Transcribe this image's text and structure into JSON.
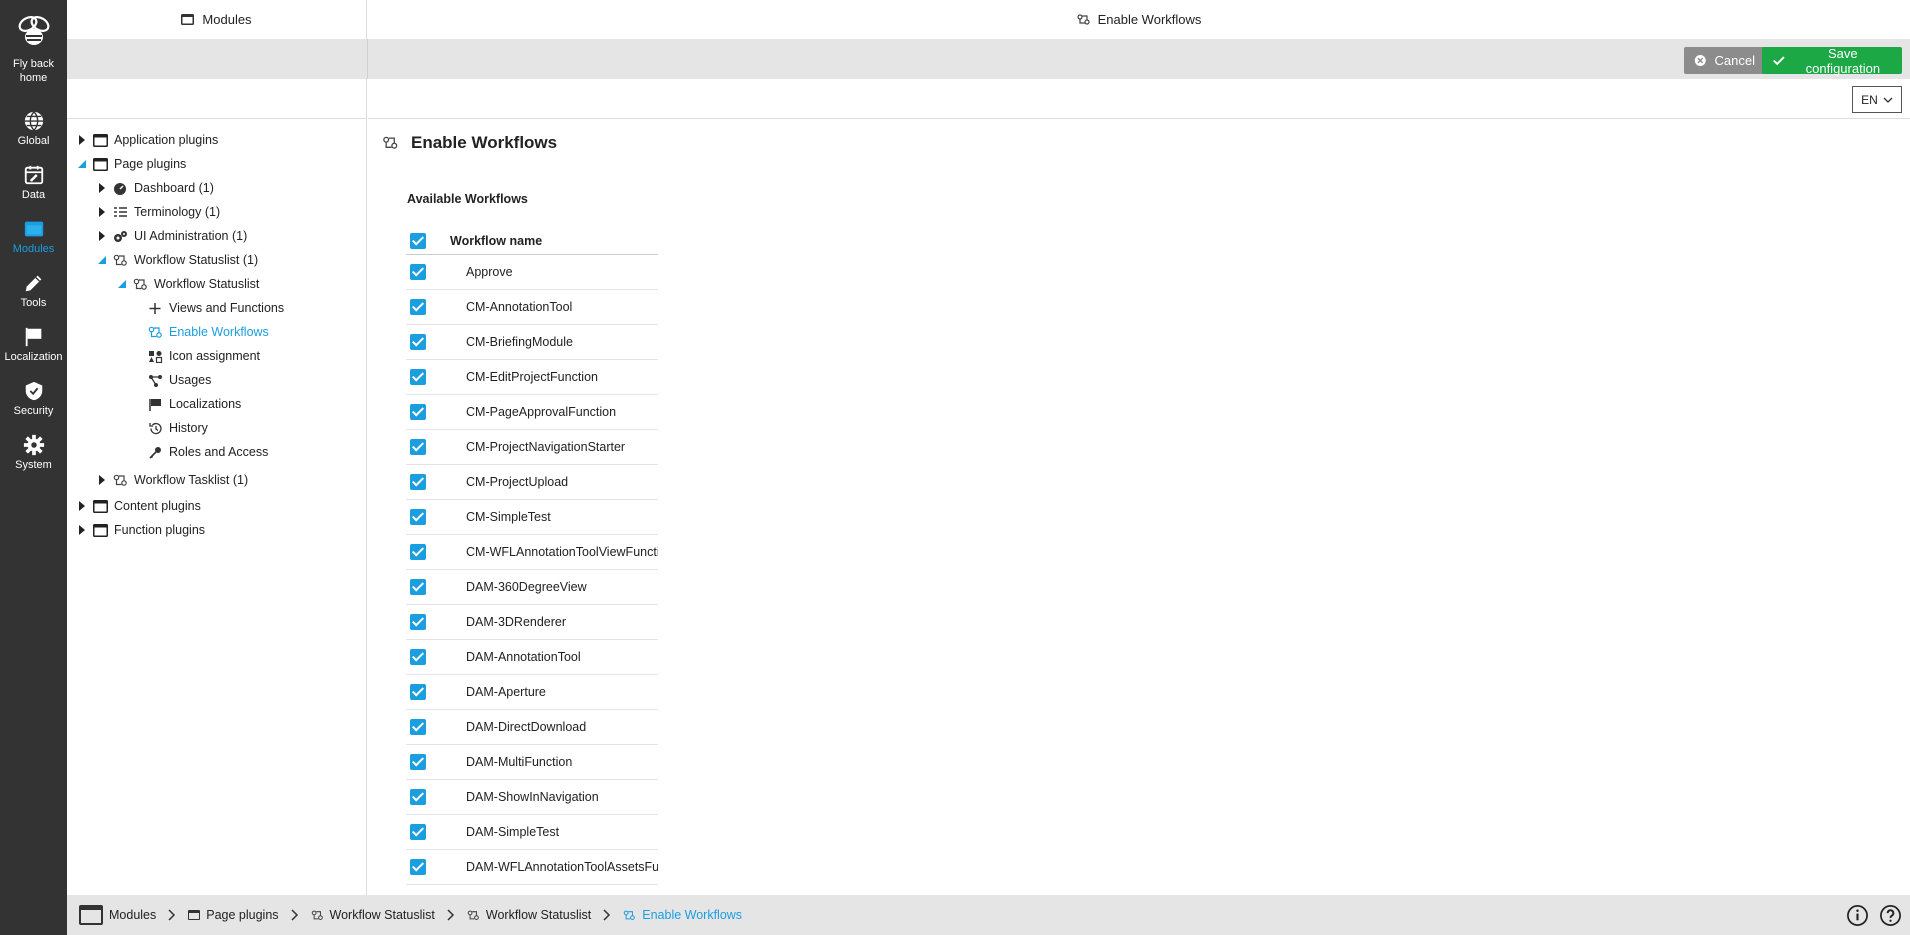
{
  "rail": {
    "home_label": "Fly back home",
    "items": [
      {
        "label": "Global",
        "icon": "globe-icon"
      },
      {
        "label": "Data",
        "icon": "calendar-edit-icon"
      },
      {
        "label": "Modules",
        "icon": "window-icon",
        "active": true
      },
      {
        "label": "Tools",
        "icon": "pencil-icon"
      },
      {
        "label": "Localization",
        "icon": "flag-icon"
      },
      {
        "label": "Security",
        "icon": "shield-check-icon"
      },
      {
        "label": "System",
        "icon": "gear-icon"
      }
    ]
  },
  "header": {
    "left_title": "Modules",
    "right_title": "Enable Workflows"
  },
  "toolbar": {
    "cancel_label": "Cancel",
    "save_label": "Save configuration"
  },
  "language": {
    "selected": "EN"
  },
  "tree": [
    {
      "label": "Application plugins"
    },
    {
      "label": "Page plugins"
    },
    {
      "label": "Dashboard (1)"
    },
    {
      "label": "Terminology (1)"
    },
    {
      "label": "UI Administration (1)"
    },
    {
      "label": "Workflow Statuslist (1)"
    },
    {
      "label": "Workflow Statuslist"
    },
    {
      "label": "Views and Functions"
    },
    {
      "label": "Enable Workflows",
      "selected": true
    },
    {
      "label": "Icon assignment"
    },
    {
      "label": "Usages"
    },
    {
      "label": "Localizations"
    },
    {
      "label": "History"
    },
    {
      "label": "Roles and Access"
    },
    {
      "label": "Workflow Tasklist (1)"
    },
    {
      "label": "Content plugins"
    },
    {
      "label": "Function plugins"
    }
  ],
  "content": {
    "title": "Enable Workflows",
    "section": "Available Workflows",
    "column_header": "Workflow name",
    "workflows": [
      "Approve",
      "CM-AnnotationTool",
      "CM-BriefingModule",
      "CM-EditProjectFunction",
      "CM-PageApprovalFunction",
      "CM-ProjectNavigationStarter",
      "CM-ProjectUpload",
      "CM-SimpleTest",
      "CM-WFLAnnotationToolViewFunctio",
      "DAM-360DegreeView",
      "DAM-3DRenderer",
      "DAM-AnnotationTool",
      "DAM-Aperture",
      "DAM-DirectDownload",
      "DAM-MultiFunction",
      "DAM-ShowInNavigation",
      "DAM-SimpleTest",
      "DAM-WFLAnnotationToolAssetsFur"
    ]
  },
  "breadcrumb": [
    {
      "label": "Modules"
    },
    {
      "label": "Page plugins"
    },
    {
      "label": "Workflow Statuslist"
    },
    {
      "label": "Workflow Statuslist"
    },
    {
      "label": "Enable Workflows",
      "current": true
    }
  ],
  "colors": {
    "rail_bg": "#333333",
    "accent": "#1b9ee0",
    "save": "#1ba845",
    "cancel": "#8c8c8c",
    "bar": "#e5e5e5"
  }
}
